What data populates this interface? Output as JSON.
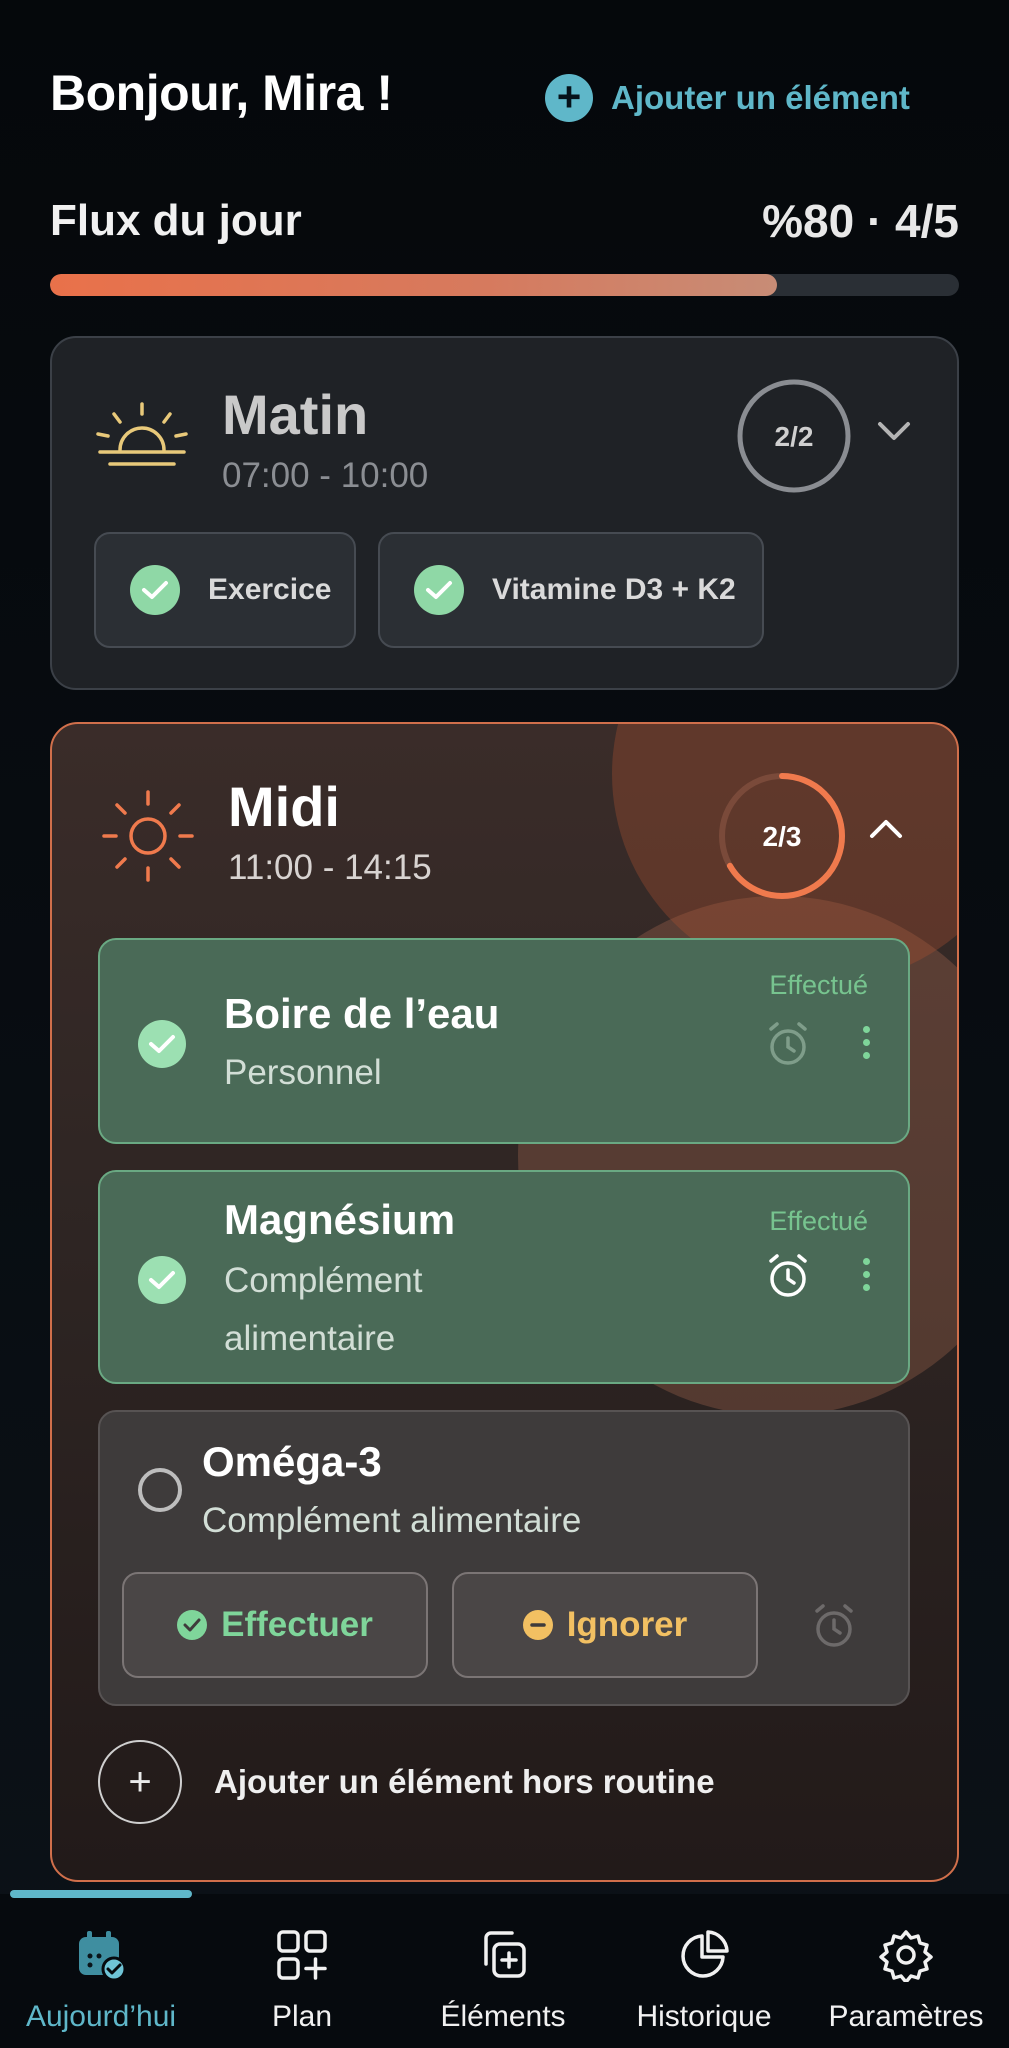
{
  "header": {
    "greeting": "Bonjour, Mira !",
    "add_label": "Ajouter un élément"
  },
  "flux": {
    "title": "Flux du jour",
    "value_text": "%80 · 4/5",
    "progress": 0.8
  },
  "routines": [
    {
      "title": "Matin",
      "time": "07:00 - 10:00",
      "progress_text": "2/2",
      "progress": 1.0,
      "expanded": false,
      "chips": [
        {
          "label": "Exercice",
          "done": true
        },
        {
          "label": "Vitamine D3 + K2",
          "done": true
        }
      ]
    },
    {
      "title": "Midi",
      "time": "11:00 - 14:15",
      "progress_text": "2/3",
      "progress": 0.667,
      "expanded": true,
      "tasks": [
        {
          "title": "Boire de l’eau",
          "category": "Personnel",
          "status": "Effectué",
          "done": true
        },
        {
          "title": "Magnésium",
          "category_line1": "Complément",
          "category_line2": "alimentaire",
          "status": "Effectué",
          "done": true
        },
        {
          "title": "Oméga-3",
          "category": "Complément alimentaire",
          "done": false,
          "action_done": "Effectuer",
          "action_skip": "Ignorer"
        }
      ],
      "add_label": "Ajouter un élément hors routine"
    }
  ],
  "colors": {
    "accent": "#5fb7c9",
    "routine_active": "#e9714a",
    "success": "#7fd59a",
    "warning": "#f2c062"
  },
  "nav": [
    {
      "label": "Aujourd’hui",
      "icon": "calendar-check-icon",
      "active": true
    },
    {
      "label": "Plan",
      "icon": "grid-plus-icon",
      "active": false
    },
    {
      "label": "Éléments",
      "icon": "copy-plus-icon",
      "active": false
    },
    {
      "label": "Historique",
      "icon": "pie-chart-icon",
      "active": false
    },
    {
      "label": "Paramètres",
      "icon": "gear-icon",
      "active": false
    }
  ]
}
